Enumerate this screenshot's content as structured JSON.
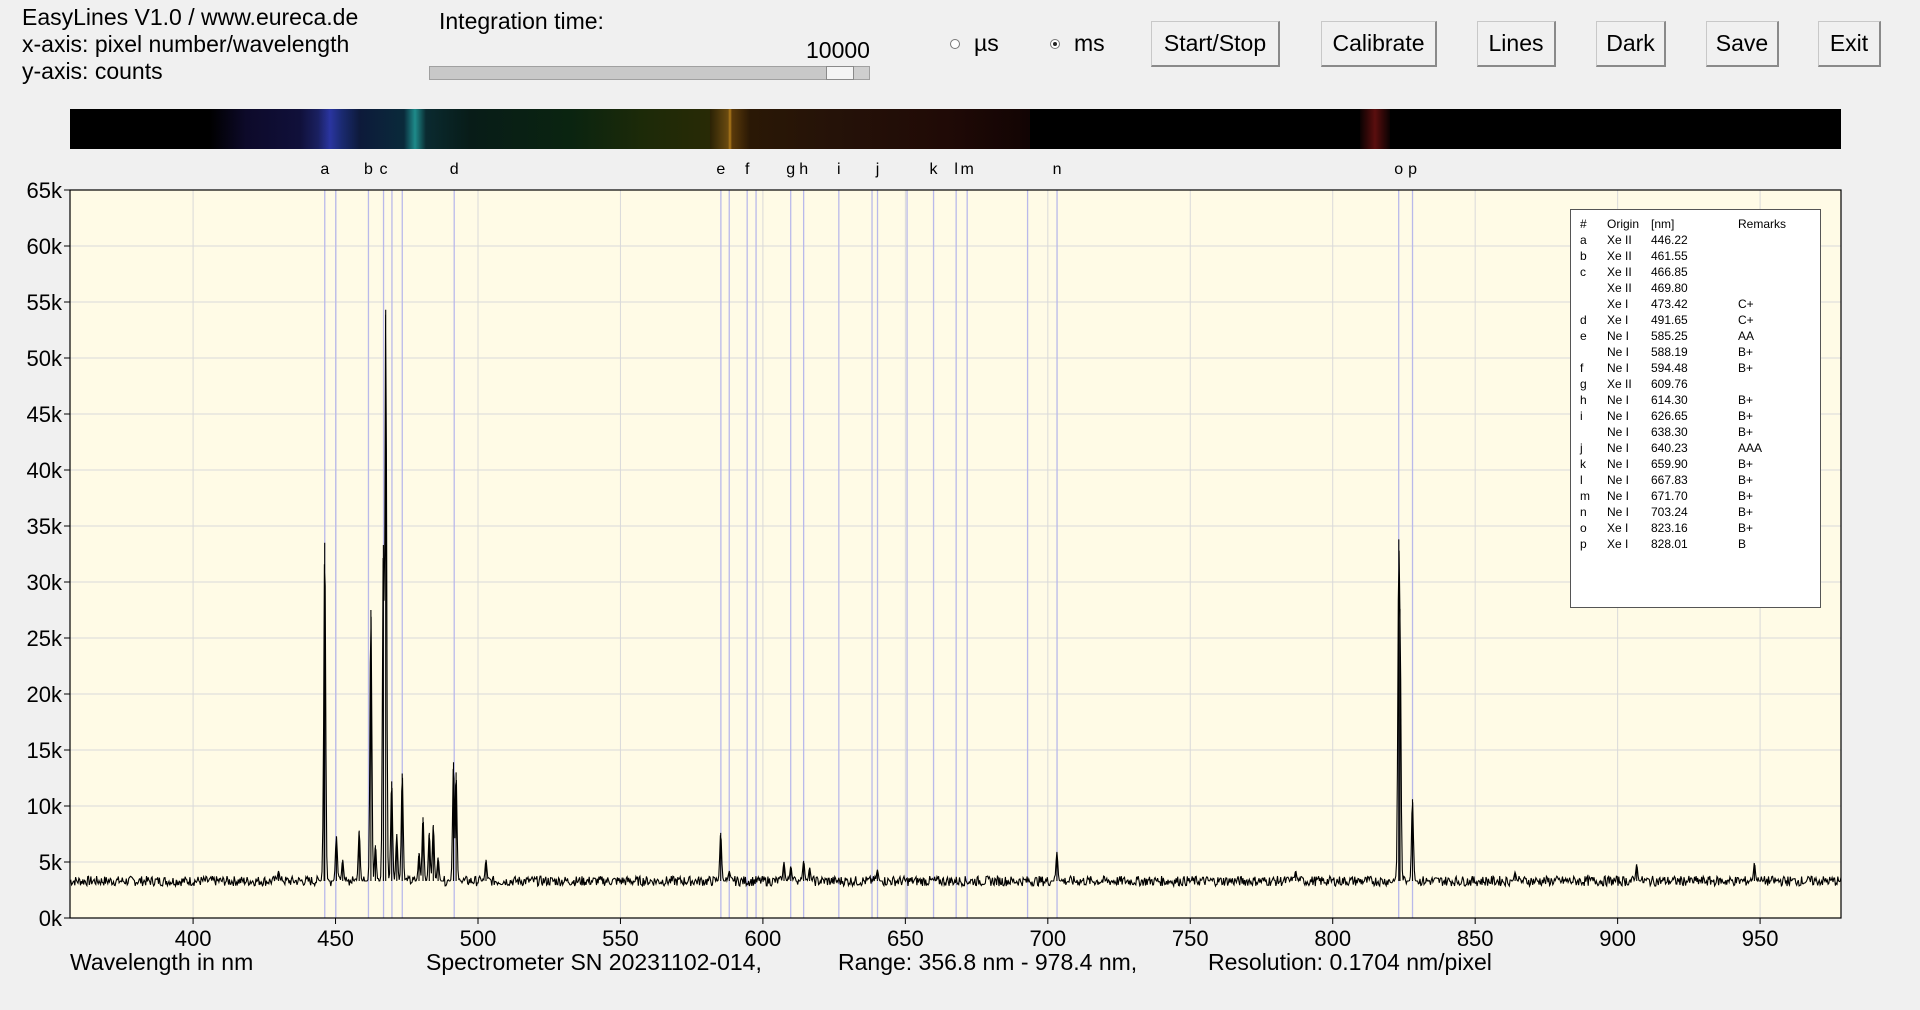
{
  "app": {
    "title_line": "EasyLines V1.0 / www.eureca.de",
    "xaxis_line": "x-axis: pixel number/wavelength",
    "yaxis_line": "y-axis: counts"
  },
  "integration": {
    "label": "Integration time:",
    "value": "10000",
    "slider_fraction": 0.96,
    "unit_us": "µs",
    "unit_ms": "ms",
    "selected_unit": "ms"
  },
  "buttons": {
    "start_stop": "Start/Stop",
    "calibrate": "Calibrate",
    "lines": "Lines",
    "dark": "Dark",
    "save": "Save",
    "exit": "Exit"
  },
  "chart_data": {
    "type": "line",
    "xlabel": "Wavelength in nm",
    "xlim": [
      356.8,
      978.4
    ],
    "ylim": [
      0,
      65000
    ],
    "x_ticks": [
      400,
      450,
      500,
      550,
      600,
      650,
      700,
      750,
      800,
      850,
      900,
      950
    ],
    "y_ticks": [
      0,
      5000,
      10000,
      15000,
      20000,
      25000,
      30000,
      35000,
      40000,
      45000,
      50000,
      55000,
      60000,
      65000
    ],
    "y_tick_labels": [
      "0k",
      "5k",
      "10k",
      "15k",
      "20k",
      "25k",
      "30k",
      "35k",
      "40k",
      "45k",
      "50k",
      "55k",
      "60k",
      "65k"
    ],
    "grid": true,
    "baseline": 3300,
    "peaks": [
      {
        "x": 430.0,
        "y": 4200
      },
      {
        "x": 446.2,
        "y": 33500
      },
      {
        "x": 446.0,
        "y": 18000
      },
      {
        "x": 450.3,
        "y": 7300
      },
      {
        "x": 452.5,
        "y": 5200
      },
      {
        "x": 458.3,
        "y": 7800
      },
      {
        "x": 462.4,
        "y": 27500
      },
      {
        "x": 464.0,
        "y": 6500
      },
      {
        "x": 466.8,
        "y": 33300
      },
      {
        "x": 467.6,
        "y": 54300
      },
      {
        "x": 469.7,
        "y": 12200
      },
      {
        "x": 471.5,
        "y": 7500
      },
      {
        "x": 473.4,
        "y": 12900
      },
      {
        "x": 479.3,
        "y": 5800
      },
      {
        "x": 480.7,
        "y": 9000
      },
      {
        "x": 482.9,
        "y": 7600
      },
      {
        "x": 484.3,
        "y": 8300
      },
      {
        "x": 486.0,
        "y": 5400
      },
      {
        "x": 491.4,
        "y": 13900
      },
      {
        "x": 492.3,
        "y": 13000
      },
      {
        "x": 502.8,
        "y": 5200
      },
      {
        "x": 585.2,
        "y": 7600
      },
      {
        "x": 588.2,
        "y": 4200
      },
      {
        "x": 607.4,
        "y": 5000
      },
      {
        "x": 609.8,
        "y": 4600
      },
      {
        "x": 614.3,
        "y": 5100
      },
      {
        "x": 616.4,
        "y": 4500
      },
      {
        "x": 640.2,
        "y": 4300
      },
      {
        "x": 703.2,
        "y": 5900
      },
      {
        "x": 787.0,
        "y": 4200
      },
      {
        "x": 823.2,
        "y": 33800
      },
      {
        "x": 823.6,
        "y": 27600
      },
      {
        "x": 828.0,
        "y": 10600
      },
      {
        "x": 864.0,
        "y": 4100
      },
      {
        "x": 906.7,
        "y": 4800
      },
      {
        "x": 948.0,
        "y": 4900
      }
    ],
    "line_markers": [
      {
        "letter": "a",
        "x": 446.22
      },
      {
        "letter": "",
        "x": 450.1
      },
      {
        "letter": "b",
        "x": 461.55
      },
      {
        "letter": "c",
        "x": 466.85
      },
      {
        "letter": "",
        "x": 469.8
      },
      {
        "letter": "",
        "x": 473.42
      },
      {
        "letter": "d",
        "x": 491.65
      },
      {
        "letter": "e",
        "x": 585.25
      },
      {
        "letter": "",
        "x": 588.19
      },
      {
        "letter": "f",
        "x": 594.48
      },
      {
        "letter": "",
        "x": 597.6
      },
      {
        "letter": "g",
        "x": 609.76
      },
      {
        "letter": "h",
        "x": 614.3
      },
      {
        "letter": "i",
        "x": 626.65
      },
      {
        "letter": "",
        "x": 638.3
      },
      {
        "letter": "j",
        "x": 640.23
      },
      {
        "letter": "",
        "x": 650.6
      },
      {
        "letter": "k",
        "x": 659.9
      },
      {
        "letter": "l",
        "x": 667.83
      },
      {
        "letter": "m",
        "x": 671.7
      },
      {
        "letter": "",
        "x": 692.9
      },
      {
        "letter": "n",
        "x": 703.24
      },
      {
        "letter": "o",
        "x": 823.16
      },
      {
        "letter": "p",
        "x": 828.01
      }
    ]
  },
  "legend": {
    "header": [
      "#",
      "Origin",
      "[nm]",
      "Remarks"
    ],
    "rows": [
      [
        "a",
        "Xe II",
        "446.22",
        ""
      ],
      [
        "b",
        "Xe II",
        "461.55",
        ""
      ],
      [
        "c",
        "Xe II",
        "466.85",
        ""
      ],
      [
        "",
        "Xe II",
        "469.80",
        ""
      ],
      [
        "",
        "Xe I",
        "473.42",
        "C+"
      ],
      [
        "d",
        "Xe I",
        "491.65",
        "C+"
      ],
      [
        "e",
        "Ne I",
        "585.25",
        "AA"
      ],
      [
        "",
        "Ne I",
        "588.19",
        "B+"
      ],
      [
        "f",
        "Ne I",
        "594.48",
        "B+"
      ],
      [
        "g",
        "Xe II",
        "609.76",
        ""
      ],
      [
        "h",
        "Ne I",
        "614.30",
        "B+"
      ],
      [
        "i",
        "Ne I",
        "626.65",
        "B+"
      ],
      [
        "",
        "Ne I",
        "638.30",
        "B+"
      ],
      [
        "j",
        "Ne I",
        "640.23",
        "AAA"
      ],
      [
        "k",
        "Ne I",
        "659.90",
        "B+"
      ],
      [
        "l",
        "Ne I",
        "667.83",
        "B+"
      ],
      [
        "m",
        "Ne I",
        "671.70",
        "B+"
      ],
      [
        "n",
        "Ne I",
        "703.24",
        "B+"
      ],
      [
        "o",
        "Xe I",
        "823.16",
        "B+"
      ],
      [
        "p",
        "Xe I",
        "828.01",
        "B"
      ]
    ]
  },
  "footer": {
    "spectrometer": "Spectrometer SN 20231102-014,",
    "range": "Range: 356.8 nm - 978.4 nm,",
    "resolution": "Resolution: 0.1704 nm/pixel"
  },
  "colors": {
    "plot_bg": "#fffbe6",
    "grid": "#d9d9d9",
    "marker_line": "#b9b9ea",
    "trace": "#000000"
  }
}
